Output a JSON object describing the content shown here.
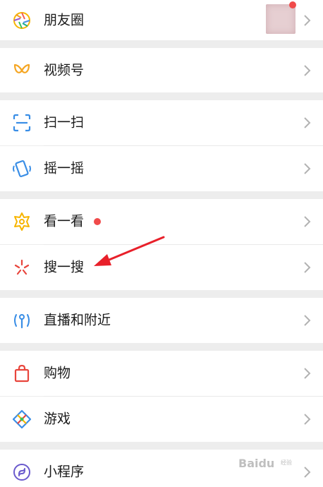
{
  "menu": {
    "moments": {
      "label": "朋友圈"
    },
    "channels": {
      "label": "视频号"
    },
    "scan": {
      "label": "扫一扫"
    },
    "shake": {
      "label": "摇一摇"
    },
    "top_stories": {
      "label": "看一看"
    },
    "search": {
      "label": "搜一搜"
    },
    "live_nearby": {
      "label": "直播和附近"
    },
    "shopping": {
      "label": "购物"
    },
    "games": {
      "label": "游戏"
    },
    "mini_programs": {
      "label": "小程序"
    }
  },
  "watermark": {
    "text": "Baidu",
    "sub": "经验"
  },
  "colors": {
    "background": "#ededed",
    "row": "#ffffff",
    "text": "#1a1a1a",
    "chevron": "#b2b2b2",
    "badge": "#f04a4a",
    "arrow": "#e8202a"
  }
}
